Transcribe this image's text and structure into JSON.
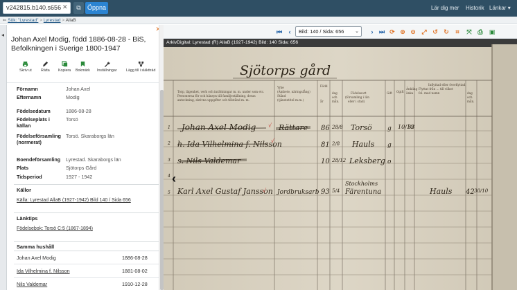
{
  "topbar": {
    "search_value": "v242815.b140.s656",
    "open_label": "Öppna",
    "nav": [
      "Lär dig mer",
      "Historik",
      "Länkar"
    ]
  },
  "breadcrumb": [
    "Sök: \"Lyrestad\"",
    "Lyrestad",
    "AllaB"
  ],
  "panel": {
    "title": "Johan Axel Modig, född 1886-08-28 - BiS, Befolkningen i Sverige 1800-1947",
    "tools": [
      "Skriv ut",
      "Rätta",
      "Kopiera",
      "Bokmärk",
      "Inställningar",
      "Lägg till i släktträd"
    ],
    "person": {
      "fornamn_label": "Förnamn",
      "fornamn": "Johan Axel",
      "efternamn_label": "Efternamn",
      "efternamn": "Modig",
      "fodelsedatum_label": "Födelsedatum",
      "fodelsedatum": "1886-08-28",
      "fodelseplats_label": "Födelseplats i källan",
      "fodelseplats": "Torsö",
      "fodelseforsamling_label": "Födelseförsamling (normerat)",
      "fodelseforsamling": "Torsö. Skaraborgs län",
      "boendeforsamling_label": "Boendeförsamling",
      "boendeforsamling": "Lyrestad. Skaraborgs län",
      "plats_label": "Plats",
      "plats": "Sjötorps Gård",
      "tidsperiod_label": "Tidsperiod",
      "tidsperiod": "1927 - 1942"
    },
    "kallor_heading": "Källor",
    "kalla_link": "Källa: Lyrestad AllaB (1927-1942) Bild 140 / Sida 656",
    "lanktips_heading": "Länktips",
    "lanktips_link": "Födelsebok: Torsö C:5 (1867-1894)",
    "household_heading": "Samma hushåll",
    "household": [
      {
        "name": "Johan Axel Modig",
        "date": "1886-08-28"
      },
      {
        "name": "Ida Vilhelmina f. Nilsson",
        "date": "1881-08-02"
      },
      {
        "name": "Nils Valdemar",
        "date": "1910-12-28"
      }
    ]
  },
  "viewer": {
    "page_select": "Bild: 140 / Sida: 656",
    "caption": "ArkivDigital: Lyrestad (R) AllaB (1927-1942) Bild: 140 Sida: 656"
  },
  "document": {
    "title": "Sjötorps gård",
    "header_cols": [
      "Torp, lägenhet, verk och inrättningar m. m. under som etc.",
      "Yrke (Ämbete, näringsfång)",
      "Född år",
      "dag och månad",
      "Födelseort (församling i län eller i stad)",
      "Gift, är ogift",
      "Änkling, änka, frånskild",
      "Inflyttad eller överflyttad",
      "dag och månad"
    ],
    "rows": [
      {
        "num": "1",
        "name": "Johan Axel Modig",
        "occupation": "Rättare",
        "year": "86",
        "day": "28/8",
        "place": "Torsö",
        "status": "g",
        "extra": "10/10 33"
      },
      {
        "num": "2",
        "name": "h. Ida Vilhelmina f. Nilsson",
        "occupation": "",
        "year": "81",
        "day": "2/8",
        "place": "Hauls",
        "status": "g",
        "extra": ""
      },
      {
        "num": "3",
        "name": "s. Nils Valdemar",
        "occupation": "",
        "year": "10",
        "day": "28/12",
        "place": "Leksberg",
        "status": "o",
        "extra": ""
      },
      {
        "num": "4",
        "name": "",
        "occupation": "",
        "year": "",
        "day": "",
        "place": "",
        "status": "",
        "extra": ""
      },
      {
        "num": "5",
        "name": "Karl Axel Gustaf Jansson",
        "occupation": "Jordbruksarb",
        "year": "93",
        "day": "5/4",
        "place": "Stockholms Färentuna",
        "status": "",
        "extra": "Hauls 42 30/10"
      }
    ]
  },
  "colors": {
    "topbar": "#2f4f64",
    "accent": "#2b84d2",
    "icon_blue": "#2463a8",
    "icon_green": "#2a8a3a",
    "icon_orange": "#e07020"
  }
}
